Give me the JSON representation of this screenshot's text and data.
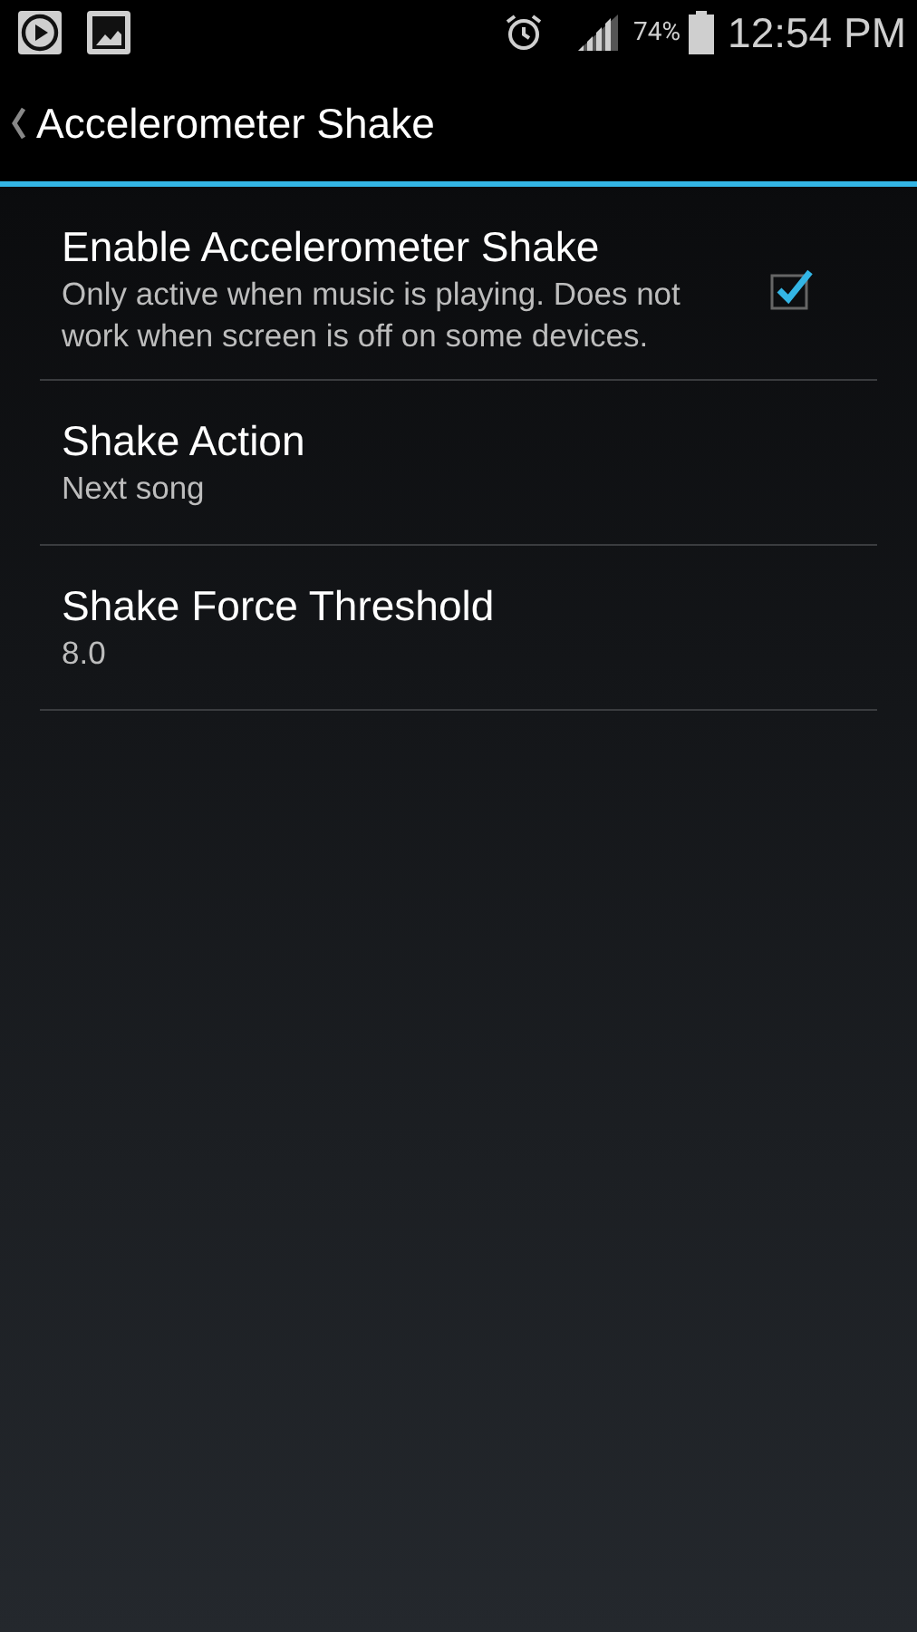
{
  "status_bar": {
    "battery_text": "74%",
    "time": "12:54 PM"
  },
  "action_bar": {
    "title": "Accelerometer Shake"
  },
  "preferences": [
    {
      "kind": "checkbox",
      "title": "Enable Accelerometer Shake",
      "summary": "Only active when music is playing. Does not work when screen is off on some devices.",
      "checked": true
    },
    {
      "kind": "plain",
      "title": "Shake Action",
      "summary": "Next song"
    },
    {
      "kind": "plain",
      "title": "Shake Force Threshold",
      "summary": "8.0"
    }
  ]
}
